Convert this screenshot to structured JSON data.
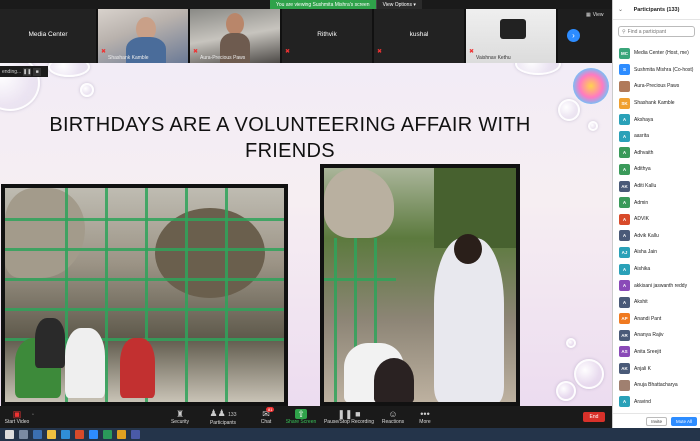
{
  "banner": {
    "message": "You are viewing Sushmita Mishra's screen",
    "view_options": "View Options"
  },
  "strip": {
    "tiles": [
      {
        "name": "Media Center"
      },
      {
        "name": "Shashank Kamble"
      },
      {
        "name": "Aura-Precious Paws"
      },
      {
        "name": "Rithvik"
      },
      {
        "name": "kushal"
      },
      {
        "name": "Vaishnav Kethu"
      }
    ]
  },
  "view_label": "View",
  "mini_bar": {
    "label": "ending..."
  },
  "slide": {
    "title": "BIRTHDAYS ARE A VOLUNTEERING AFFAIR WITH FRIENDS"
  },
  "toolbar": {
    "start_video": "Start Video",
    "security": "Security",
    "participants": "Participants",
    "participants_count": "133",
    "chat": "Chat",
    "chat_badge": "81",
    "share_screen": "Share Screen",
    "recording": "Pause/Stop Recording",
    "reactions": "Reactions",
    "more": "More",
    "end": "End"
  },
  "panel": {
    "title": "Participants (133)",
    "search_placeholder": "Find a participant",
    "participants": [
      {
        "initials": "MC",
        "name": "Media Center (Host, me)",
        "color": "#3aa57a"
      },
      {
        "initials": "S",
        "name": "Sushmita Mishra (Co-host)",
        "color": "#2d8cff"
      },
      {
        "initials": "",
        "name": "Aura-Precious Paws",
        "color": "#b07a5a"
      },
      {
        "initials": "SK",
        "name": "Shashank Kamble",
        "color": "#f0a030"
      },
      {
        "initials": "A",
        "name": "Akshaya",
        "color": "#2aa1b8"
      },
      {
        "initials": "A",
        "name": "aasrita",
        "color": "#2aa1b8"
      },
      {
        "initials": "A",
        "name": "Adhvaith",
        "color": "#3a9a5a"
      },
      {
        "initials": "A",
        "name": "Adithya",
        "color": "#3a9a5a"
      },
      {
        "initials": "AK",
        "name": "Aditi Kallu",
        "color": "#4a5a78"
      },
      {
        "initials": "A",
        "name": "Admin",
        "color": "#3a9a5a"
      },
      {
        "initials": "A",
        "name": "ADVIK",
        "color": "#d84a2a"
      },
      {
        "initials": "A",
        "name": "Advik Kallu",
        "color": "#4a5a78"
      },
      {
        "initials": "AJ",
        "name": "Aisha Jain",
        "color": "#2aa1b8"
      },
      {
        "initials": "A",
        "name": "Aishika",
        "color": "#2aa1b8"
      },
      {
        "initials": "A",
        "name": "akkisani jaswanth reddy",
        "color": "#8a4ab8"
      },
      {
        "initials": "A",
        "name": "Akshit",
        "color": "#4a5a78"
      },
      {
        "initials": "AP",
        "name": "Anandi Pant",
        "color": "#f07a20"
      },
      {
        "initials": "AR",
        "name": "Ananya Rajiv",
        "color": "#4a5a78"
      },
      {
        "initials": "AS",
        "name": "Anita Sreejit",
        "color": "#8a4ab8"
      },
      {
        "initials": "AK",
        "name": "Anjali K",
        "color": "#4a5a78"
      },
      {
        "initials": "",
        "name": "Anuja Bhattacharya",
        "color": "#a08070"
      },
      {
        "initials": "A",
        "name": "Aravind",
        "color": "#2aa1b8"
      }
    ],
    "invite": "Invite",
    "mute_all": "Mute All"
  }
}
